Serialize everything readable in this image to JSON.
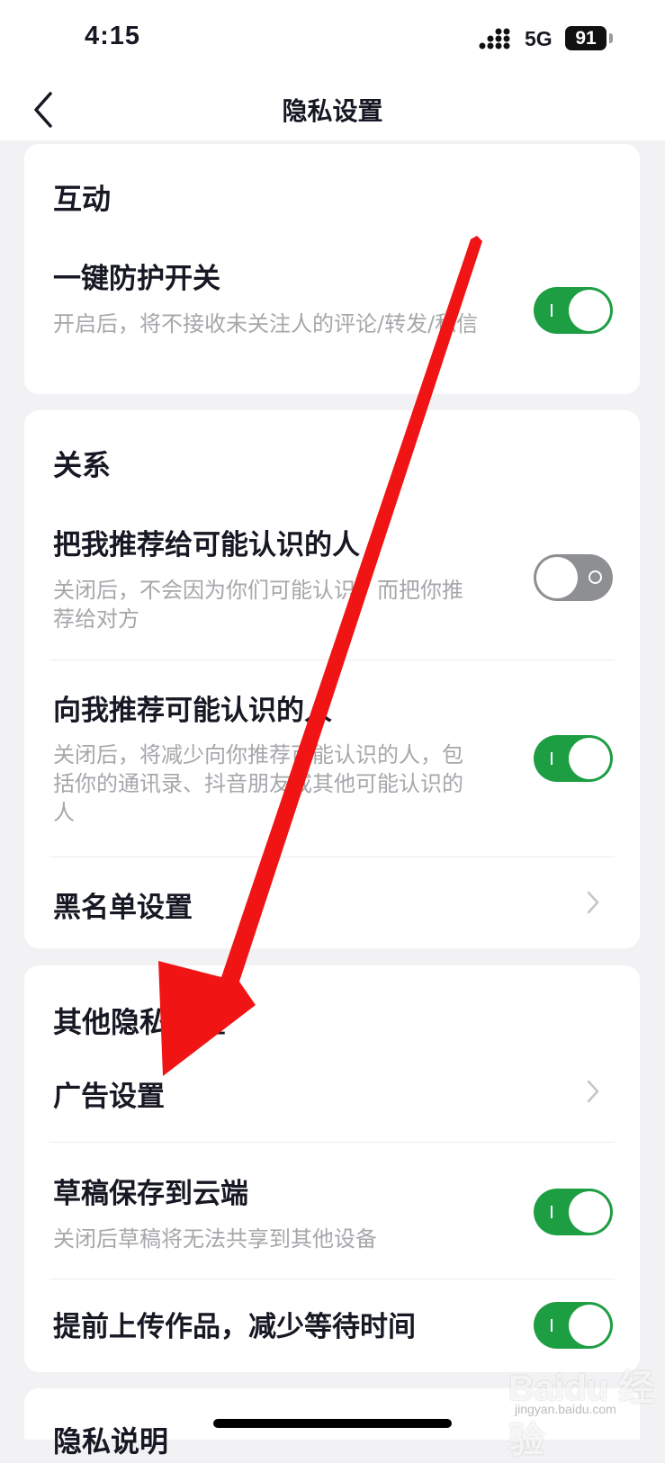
{
  "status_bar": {
    "time": "4:15",
    "network": "5G",
    "battery": "91"
  },
  "nav": {
    "title": "隐私设置"
  },
  "sections": {
    "interaction": {
      "title": "互动",
      "one_key_protection": {
        "title": "一键防护开关",
        "desc": "开启后，将不接收未关注人的评论/转发/私信",
        "enabled": true
      }
    },
    "relationship": {
      "title": "关系",
      "recommend_me": {
        "title": "把我推荐给可能认识的人",
        "desc": "关闭后，不会因为你们可能认识，而把你推荐给对方",
        "enabled": false
      },
      "recommend_to_me": {
        "title": "向我推荐可能认识的人",
        "desc": "关闭后，将减少向你推荐可能认识的人，包括你的通讯录、抖音朋友或其他可能认识的人",
        "enabled": true
      },
      "blacklist": {
        "title": "黑名单设置"
      }
    },
    "other": {
      "title": "其他隐私设置",
      "ads": {
        "title": "广告设置"
      },
      "drafts_cloud": {
        "title": "草稿保存到云端",
        "desc": "关闭后草稿将无法共享到其他设备",
        "enabled": true
      },
      "pre_upload": {
        "title": "提前上传作品，减少等待时间",
        "enabled": true
      }
    },
    "privacy_notice": {
      "title": "隐私说明"
    }
  },
  "watermark": {
    "brand": "Baidu 经验",
    "sub": "jingyan.baidu.com"
  },
  "colors": {
    "toggle_on": "#1e9e43",
    "toggle_off": "#8e8f93",
    "annotation_arrow": "#f01414"
  }
}
